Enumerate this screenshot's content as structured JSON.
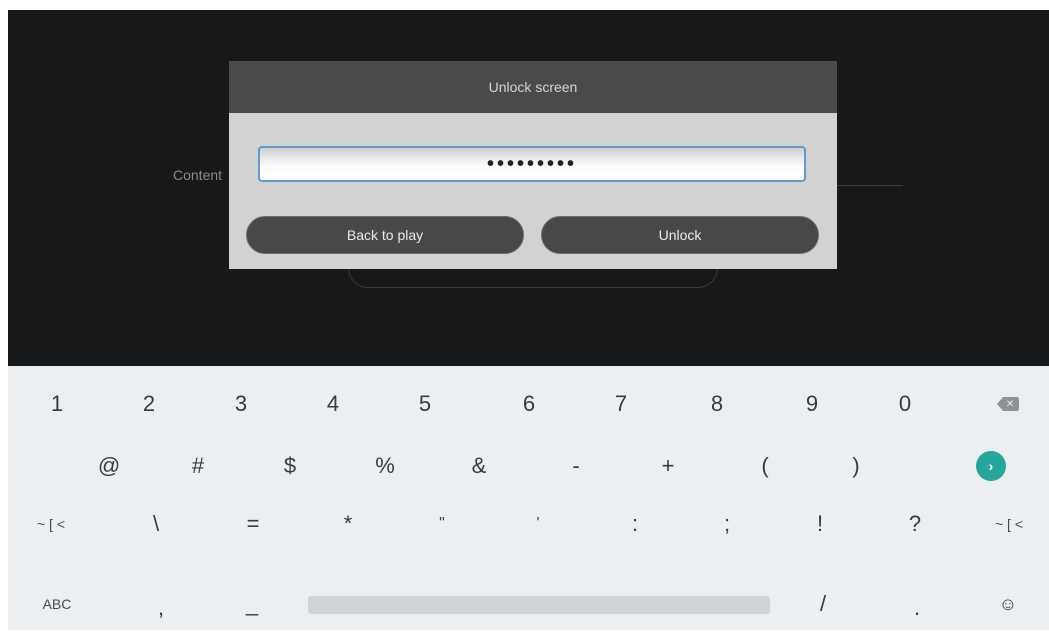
{
  "background": {
    "content_label": "Content"
  },
  "dialog": {
    "title": "Unlock screen",
    "password_value": "•••••••••",
    "back_label": "Back to play",
    "unlock_label": "Unlock"
  },
  "keyboard": {
    "row1": [
      "1",
      "2",
      "3",
      "4",
      "5",
      "6",
      "7",
      "8",
      "9",
      "0"
    ],
    "row2": [
      "@",
      "#",
      "$",
      "%",
      "&",
      "-",
      "+",
      "(",
      ")"
    ],
    "row3_left": "~ [ <",
    "row3": [
      "\\",
      "=",
      "*",
      "\"",
      "'",
      ":",
      ";",
      "!",
      "?"
    ],
    "row3_right": "~ [ <",
    "abc_label": "ABC",
    "comma": ",",
    "underscore": "_",
    "slash": "/",
    "period": ".",
    "emoji": "☺",
    "backspace_glyph": "✕",
    "enter_glyph": "›"
  },
  "colors": {
    "accent": "#26a69a",
    "input_border": "#5f9ad1",
    "dialog_title_bg": "#4a4a4a",
    "dialog_bg": "#d2d2d2",
    "keyboard_bg": "#eceff1"
  }
}
